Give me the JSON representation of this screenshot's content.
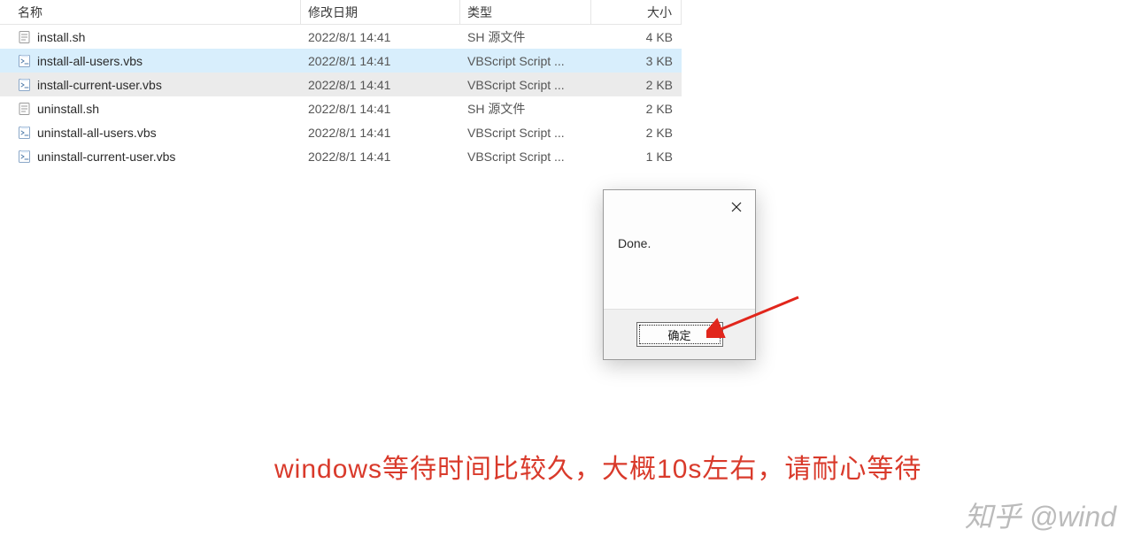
{
  "columns": {
    "name": "名称",
    "date": "修改日期",
    "type": "类型",
    "size": "大小"
  },
  "files": [
    {
      "icon": "doc",
      "name": "install.sh",
      "date": "2022/8/1 14:41",
      "type": "SH 源文件",
      "size": "4 KB",
      "state": ""
    },
    {
      "icon": "script",
      "name": "install-all-users.vbs",
      "date": "2022/8/1 14:41",
      "type": "VBScript Script ...",
      "size": "3 KB",
      "state": "selected"
    },
    {
      "icon": "script",
      "name": "install-current-user.vbs",
      "date": "2022/8/1 14:41",
      "type": "VBScript Script ...",
      "size": "2 KB",
      "state": "hover-sel"
    },
    {
      "icon": "doc",
      "name": "uninstall.sh",
      "date": "2022/8/1 14:41",
      "type": "SH 源文件",
      "size": "2 KB",
      "state": ""
    },
    {
      "icon": "script",
      "name": "uninstall-all-users.vbs",
      "date": "2022/8/1 14:41",
      "type": "VBScript Script ...",
      "size": "2 KB",
      "state": ""
    },
    {
      "icon": "script",
      "name": "uninstall-current-user.vbs",
      "date": "2022/8/1 14:41",
      "type": "VBScript Script ...",
      "size": "1 KB",
      "state": ""
    }
  ],
  "dialog": {
    "message": "Done.",
    "ok": "确定"
  },
  "annotation": "windows等待时间比较久，大概10s左右，请耐心等待",
  "watermark": "知乎 @wind"
}
